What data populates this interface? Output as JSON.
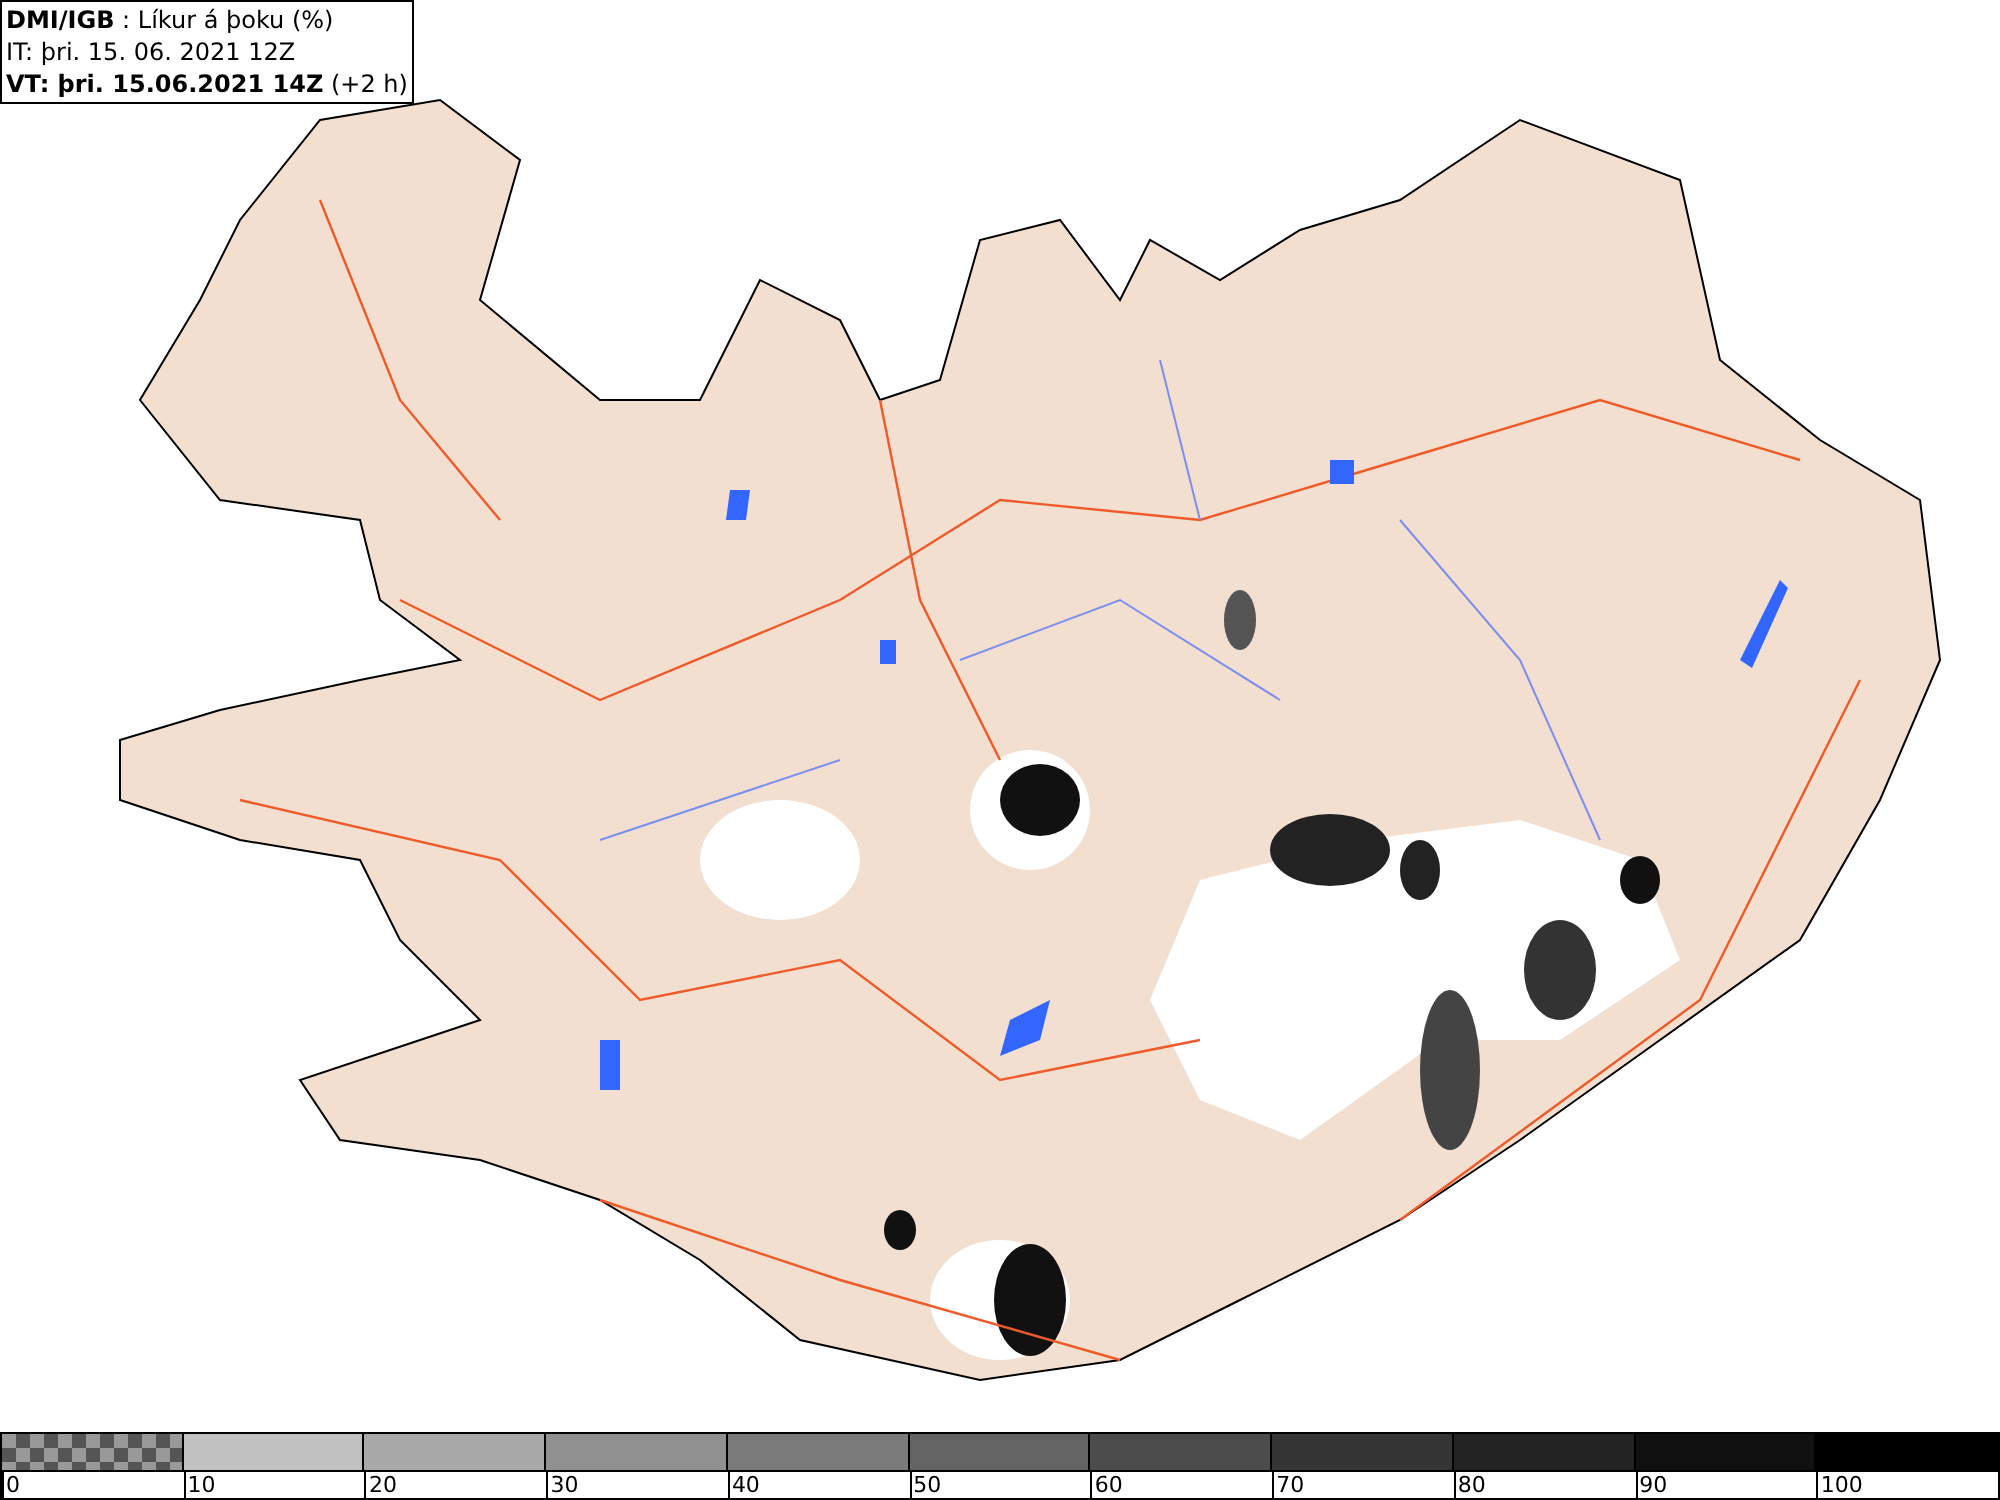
{
  "info_box": {
    "lines": [
      "**DMI/IGB** : Líkur á þoku (%)",
      "IT: þri. 15. 06. 2021 12Z",
      "**VT: þri. 15.06.2021 14Z** (+2 h)"
    ]
  },
  "legend": {
    "bins": [
      {
        "kind": "checkered",
        "label": "0"
      },
      {
        "kind": "solid",
        "color": "#c0c0c0",
        "label": "10"
      },
      {
        "kind": "solid",
        "color": "#a8a8a8",
        "label": "20"
      },
      {
        "kind": "solid",
        "color": "#909090",
        "label": "30"
      },
      {
        "kind": "solid",
        "color": "#7a7a7a",
        "label": "40"
      },
      {
        "kind": "solid",
        "color": "#646464",
        "label": "50"
      },
      {
        "kind": "solid",
        "color": "#4c4c4c",
        "label": "60"
      },
      {
        "kind": "solid",
        "color": "#353535",
        "label": "70"
      },
      {
        "kind": "solid",
        "color": "#222222",
        "label": "80"
      },
      {
        "kind": "solid",
        "color": "#111111",
        "label": "90"
      },
      {
        "kind": "solid",
        "color": "#000000",
        "label": "100"
      }
    ]
  }
}
